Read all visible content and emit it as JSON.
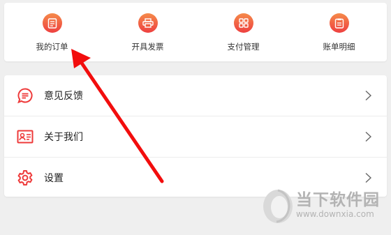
{
  "shortcuts": [
    {
      "label": "我的订单",
      "icon": "order-icon"
    },
    {
      "label": "开具发票",
      "icon": "printer-icon"
    },
    {
      "label": "支付管理",
      "icon": "grid-icon"
    },
    {
      "label": "账单明细",
      "icon": "bill-icon"
    }
  ],
  "menu": [
    {
      "label": "意见反馈",
      "icon": "chat-bubble-icon"
    },
    {
      "label": "关于我们",
      "icon": "id-card-icon"
    },
    {
      "label": "设置",
      "icon": "gear-icon"
    }
  ],
  "watermark": {
    "name": "当下软件园",
    "url": "www.downxia.com"
  },
  "colors": {
    "accent": "#ee3a3a",
    "gradient_top": "#f58a4a",
    "gradient_bottom": "#ee4040",
    "annotation_arrow": "#f20d0d"
  }
}
